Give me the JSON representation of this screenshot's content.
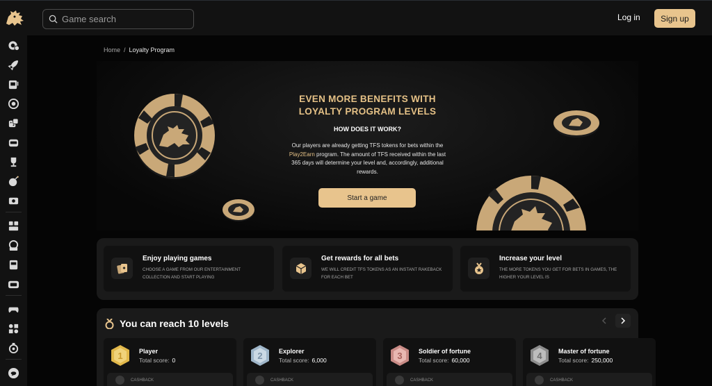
{
  "search": {
    "placeholder": "Game search"
  },
  "auth": {
    "login": "Log in",
    "signup": "Sign up"
  },
  "sidebar": {
    "icons": [
      "poker-chip-play-icon",
      "rocket-icon",
      "slot-machine-icon",
      "roulette-icon",
      "dice-icon",
      "casino-icon",
      "trophy-icon",
      "bomb-icon",
      "ticket-icon",
      "live-cards-icon",
      "live-roulette-icon",
      "live-slot-icon",
      "live-tv-icon",
      "gamepad-icon",
      "esports-icon",
      "lottery-icon",
      "support-chat-icon"
    ]
  },
  "breadcrumb": {
    "home": "Home",
    "sep": "/",
    "current": "Loyalty Program"
  },
  "hero": {
    "title_line1": "EVEN MORE BENEFITS WITH",
    "title_line2": "LOYALTY PROGRAM LEVELS",
    "subtitle": "HOW DOES IT WORK?",
    "body_1": "Our players are already getting TFS tokens for bets within the ",
    "body_link": "Play2Earn",
    "body_2": " program. The amount of TFS received within the last 365 days will determine your level and, accordingly, additional rewards.",
    "button": "Start a game"
  },
  "features": [
    {
      "title": "Enjoy playing games",
      "desc": "Choose a game from our entertainment collection and start playing",
      "icon": "cards-icon"
    },
    {
      "title": "Get rewards for all bets",
      "desc": "We will credit TFS tokens as an instant rakeback for each bet",
      "icon": "cube-icon"
    },
    {
      "title": "Increase your level",
      "desc": "The more tokens you get for bets in games, the higher your level is",
      "icon": "medal-icon"
    }
  ],
  "levels": {
    "title": "You can reach 10 levels",
    "score_label": "Total score:",
    "cashback_label": "CASHBACK",
    "items": [
      {
        "name": "Player",
        "score": "0",
        "number": "1",
        "color": "#e2b84a"
      },
      {
        "name": "Explorer",
        "score": "6,000",
        "number": "2",
        "color": "#9fb6c9"
      },
      {
        "name": "Soldier of fortune",
        "score": "60,000",
        "number": "3",
        "color": "#c98b86"
      },
      {
        "name": "Master of fortune",
        "score": "250,000",
        "number": "4",
        "color": "#9a9a9a"
      }
    ]
  },
  "colors": {
    "accent": "#e8c48d",
    "gold_text": "#e5c186",
    "bg": "#050505",
    "panel": "#1a1a1a"
  }
}
